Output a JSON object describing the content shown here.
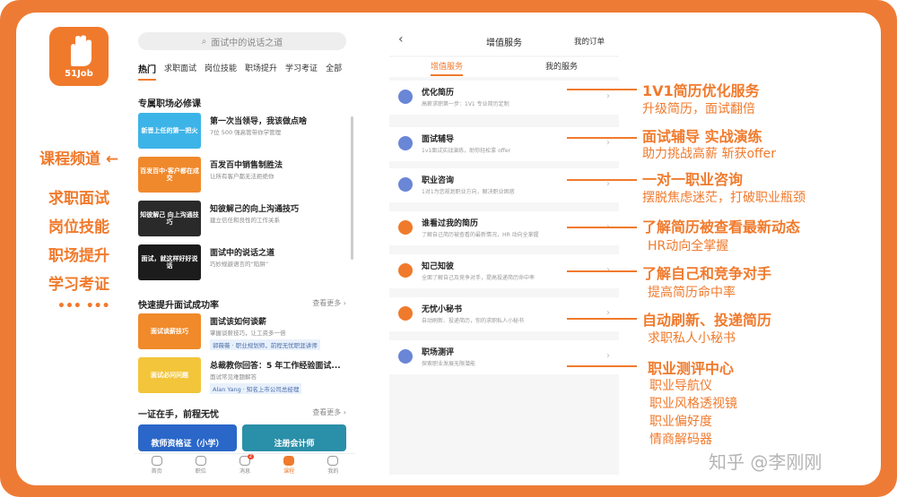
{
  "colors": {
    "accent": "#f07a2c",
    "frame": "#ee7b35"
  },
  "logo": {
    "text": "51Job"
  },
  "left_labels": {
    "channel": "课程频道",
    "items": [
      "求职面试",
      "岗位技能",
      "职场提升",
      "学习考证"
    ],
    "ellipsis": "••• •••"
  },
  "app": {
    "search_placeholder": "面试中的说话之道",
    "tabs": [
      "热门",
      "求职面试",
      "岗位技能",
      "职场提升",
      "学习考证",
      "全部"
    ],
    "section1": "专属职场必修课",
    "courses": [
      {
        "thumb": "新晋上任的第一把火",
        "title": "第一次当领导，我该做点啥",
        "sub": "7位 500 强高管带你学管理"
      },
      {
        "thumb": "百发百中·客户都在成交",
        "title": "百发百中销售制胜法",
        "sub": "让所有客户都无法拒绝你"
      },
      {
        "thumb": "知彼解己 向上沟通技巧",
        "title": "知彼解己的向上沟通技巧",
        "sub": "建立信任和良性的工作关系"
      },
      {
        "thumb": "面试，就这样好好说话",
        "title": "面试中的说话之道",
        "sub": "巧妙规避语言的“陷阱”"
      }
    ],
    "section2": "快速提升面试成功率",
    "section2_more": "查看更多 ›",
    "fast": [
      {
        "thumb": "面试谈薪技巧",
        "title": "面试该如何谈薪",
        "sub": "掌握谈薪技巧，让工资多一倍",
        "tag": "郭薇薇 · 职业规划师，前程无忧职涯讲师"
      },
      {
        "thumb": "面试必问问题",
        "title": "总裁教你回答：5 年工作经验面试...",
        "sub": "面试常见难题解答",
        "tag": "Alan Yang · 知名上市公司总经理"
      }
    ],
    "section3": "一证在手，前程无忧",
    "section3_more": "查看更多 ›",
    "certs": [
      "教师资格证（小学）",
      "注册会计师"
    ],
    "nav": [
      {
        "label": "首页"
      },
      {
        "label": "职位"
      },
      {
        "label": "消息",
        "badge": "2"
      },
      {
        "label": "课程"
      },
      {
        "label": "我的"
      }
    ]
  },
  "services": {
    "title": "增值服务",
    "orders": "我的订单",
    "tabs": [
      "增值服务",
      "我的服务"
    ],
    "items": [
      {
        "title": "优化简历",
        "sub": "高薪求职第一步：1V1 专业简历定制",
        "color": "#6a86d6"
      },
      {
        "title": "面试辅导",
        "sub": "1v1面试实战演练，助你轻松拿 offer",
        "color": "#6a86d6"
      },
      {
        "title": "职业咨询",
        "sub": "1对1为您规划职业方向，解决职业困惑",
        "color": "#6a86d6"
      },
      {
        "title": "谁看过我的简历",
        "sub": "了解自己简历被查看的最新情况，HR 动向全掌握",
        "color": "#f07a2c"
      },
      {
        "title": "知己知彼",
        "sub": "全面了解自己及竞争对手，提高投递简历命中率",
        "color": "#f07a2c"
      },
      {
        "title": "无忧小秘书",
        "sub": "自动刷新、投递简历，你的求职私人小秘书",
        "color": "#f07a2c"
      },
      {
        "title": "职场测评",
        "sub": "探索职业发展无限潜能",
        "color": "#6a86d6"
      }
    ]
  },
  "annotations": [
    {
      "head": "1V1简历优化服务",
      "sub": [
        "升级简历，面试翻倍"
      ]
    },
    {
      "head": "面试辅导 实战演练",
      "sub": [
        "助力挑战高薪 斩获offer"
      ]
    },
    {
      "head": "一对一职业咨询",
      "sub": [
        "摆脱焦虑迷茫，打破职业瓶颈"
      ]
    },
    {
      "head": "了解简历被查看最新动态",
      "sub": [
        "HR动向全掌握"
      ]
    },
    {
      "head": "了解自己和竞争对手",
      "sub": [
        "提高简历命中率"
      ]
    },
    {
      "head": "自动刷新、投递简历",
      "sub": [
        "求职私人小秘书"
      ]
    },
    {
      "head": "职业测评中心",
      "sub": [
        "职业导航仪",
        "职业风格透视镜",
        "职业偏好度",
        "情商解码器"
      ]
    }
  ],
  "watermark": "知乎 @李刚刚"
}
